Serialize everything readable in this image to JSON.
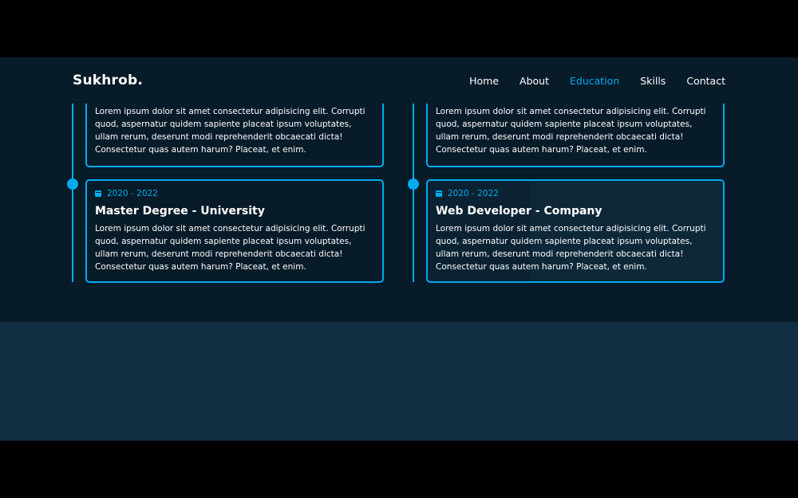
{
  "brand": {
    "logo": "Sukhrob."
  },
  "nav": {
    "items": [
      {
        "label": "Home"
      },
      {
        "label": "About"
      },
      {
        "label": "Education"
      },
      {
        "label": "Skills"
      },
      {
        "label": "Contact"
      }
    ],
    "active_index": 2,
    "active_color": "#00abf0"
  },
  "education": {
    "lorem": "Lorem ipsum dolor sit amet consectetur adipisicing elit. Corrupti quod, aspernatur quidem sapiente placeat ipsum voluptates, ullam rerum, deserunt modi reprehenderit obcaecati dicta! Consectetur quas autem harum? Placeat, et enim.",
    "left_column": {
      "top_card": {
        "text": "Lorem ipsum dolor sit amet consectetur adipisicing elit. Corrupti quod, aspernatur quidem sapiente placeat ipsum voluptates, ullam rerum, deserunt modi reprehenderit obcaecati dicta! Consectetur quas autem harum? Placeat, et enim."
      },
      "card": {
        "date": "2020 - 2022",
        "title": "Master Degree - University",
        "text": "Lorem ipsum dolor sit amet consectetur adipisicing elit. Corrupti quod, aspernatur quidem sapiente placeat ipsum voluptates, ullam rerum, deserunt modi reprehenderit obcaecati dicta! Consectetur quas autem harum? Placeat, et enim."
      }
    },
    "right_column": {
      "top_card": {
        "text": "Lorem ipsum dolor sit amet consectetur adipisicing elit. Corrupti quod, aspernatur quidem sapiente placeat ipsum voluptates, ullam rerum, deserunt modi reprehenderit obcaecati dicta! Consectetur quas autem harum? Placeat, et enim."
      },
      "card": {
        "date": "2020 - 2022",
        "title": "Web Developer - Company",
        "text": "Lorem ipsum dolor sit amet consectetur adipisicing elit. Corrupti quod, aspernatur quidem sapiente placeat ipsum voluptates, ullam rerum, deserunt modi reprehenderit obcaecati dicta! Consectetur quas autem harum? Placeat, et enim."
      }
    }
  },
  "icons": {
    "date_icon": "calendar-icon"
  },
  "colors": {
    "background": "#081b29",
    "accent": "#00abf0",
    "next_section": "#112e42"
  }
}
